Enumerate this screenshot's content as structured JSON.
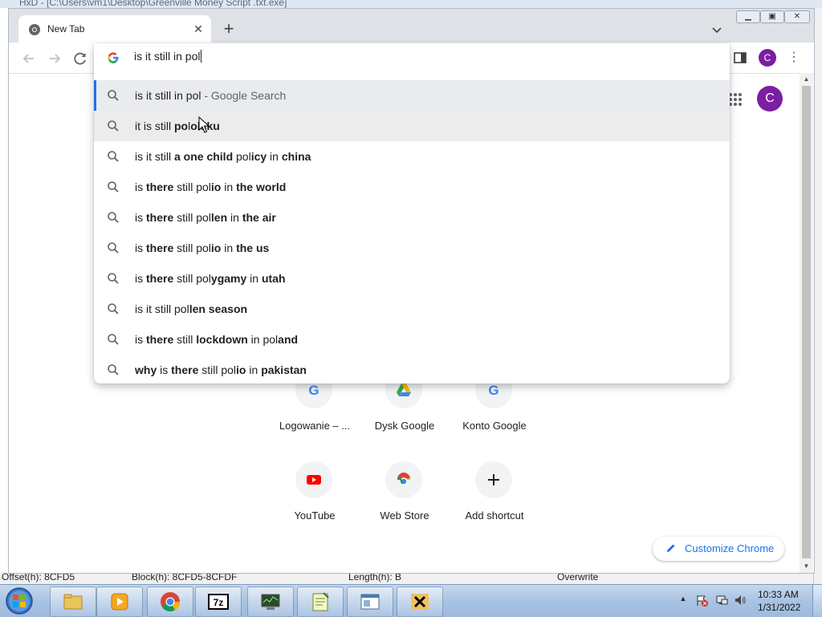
{
  "background_app": {
    "title": "HxD - [C:\\Users\\vm1\\Desktop\\Greenville Money Script .txt.exe]",
    "status": {
      "offset": "Offset(h): 8CFD5",
      "block": "Block(h): 8CFD5-8CFDF",
      "length": "Length(h): B",
      "mode": "Overwrite"
    }
  },
  "browser": {
    "tab": {
      "title": "New Tab",
      "favicon": "chrome-icon"
    },
    "profile_initial": "C",
    "omnibox": {
      "input_value": "is it still in pol",
      "suggestions": [
        {
          "parts": [
            [
              "is it still in pol",
              false
            ]
          ],
          "description": " - Google Search",
          "selected": true
        },
        {
          "parts": [
            [
              "it is still ",
              false
            ],
            [
              "po",
              true
            ],
            [
              "l",
              false
            ],
            [
              "olsku",
              true
            ]
          ],
          "hovered": true
        },
        {
          "parts": [
            [
              "is it still ",
              false
            ],
            [
              "a one child ",
              true
            ],
            [
              "pol",
              false
            ],
            [
              "icy",
              true
            ],
            [
              " in ",
              false
            ],
            [
              "china",
              true
            ]
          ]
        },
        {
          "parts": [
            [
              "is ",
              false
            ],
            [
              "there",
              true
            ],
            [
              " still ",
              false
            ],
            [
              "pol",
              false
            ],
            [
              "io",
              true
            ],
            [
              " in ",
              false
            ],
            [
              "the world",
              true
            ]
          ]
        },
        {
          "parts": [
            [
              "is ",
              false
            ],
            [
              "there",
              true
            ],
            [
              " still ",
              false
            ],
            [
              "pol",
              false
            ],
            [
              "len",
              true
            ],
            [
              " in ",
              false
            ],
            [
              "the air",
              true
            ]
          ]
        },
        {
          "parts": [
            [
              "is ",
              false
            ],
            [
              "there",
              true
            ],
            [
              " still ",
              false
            ],
            [
              "pol",
              false
            ],
            [
              "io",
              true
            ],
            [
              " in ",
              false
            ],
            [
              "the us",
              true
            ]
          ]
        },
        {
          "parts": [
            [
              "is ",
              false
            ],
            [
              "there",
              true
            ],
            [
              " still ",
              false
            ],
            [
              "pol",
              false
            ],
            [
              "ygamy",
              true
            ],
            [
              " in ",
              false
            ],
            [
              "utah",
              true
            ]
          ]
        },
        {
          "parts": [
            [
              "is it still ",
              false
            ],
            [
              "pol",
              false
            ],
            [
              "len season",
              true
            ]
          ]
        },
        {
          "parts": [
            [
              "is ",
              false
            ],
            [
              "there",
              true
            ],
            [
              " still ",
              false
            ],
            [
              "lockdown",
              true
            ],
            [
              " in ",
              false
            ],
            [
              "pol",
              false
            ],
            [
              "and",
              true
            ]
          ]
        },
        {
          "parts": [
            [
              "why",
              true
            ],
            [
              " is ",
              false
            ],
            [
              "there",
              true
            ],
            [
              " still ",
              false
            ],
            [
              "pol",
              false
            ],
            [
              "io",
              true
            ],
            [
              " in ",
              false
            ],
            [
              "pakistan",
              true
            ]
          ]
        }
      ]
    },
    "ntp": {
      "avatar_initial": "C",
      "shortcuts": [
        {
          "label": "Logowanie – ...",
          "icon": "google-icon"
        },
        {
          "label": "Dysk Google",
          "icon": "google-drive-icon"
        },
        {
          "label": "Konto Google",
          "icon": "google-icon"
        },
        {
          "label": "YouTube",
          "icon": "youtube-icon"
        },
        {
          "label": "Web Store",
          "icon": "web-store-icon"
        },
        {
          "label": "Add shortcut",
          "icon": "plus-icon"
        }
      ],
      "customize_label": "Customize Chrome"
    }
  },
  "taskbar": {
    "apps": [
      "folder-icon",
      "media-player-icon",
      "chrome-icon",
      "7zip-icon",
      "hardware-monitor-icon",
      "notepad-icon",
      "window-app-icon",
      "hxd-icon"
    ],
    "clock_time": "10:33 AM",
    "clock_date": "1/31/2022"
  },
  "colors": {
    "accent": "#1a73e8",
    "profile": "#7b1fa2",
    "selected_row": "#e9ebee"
  }
}
